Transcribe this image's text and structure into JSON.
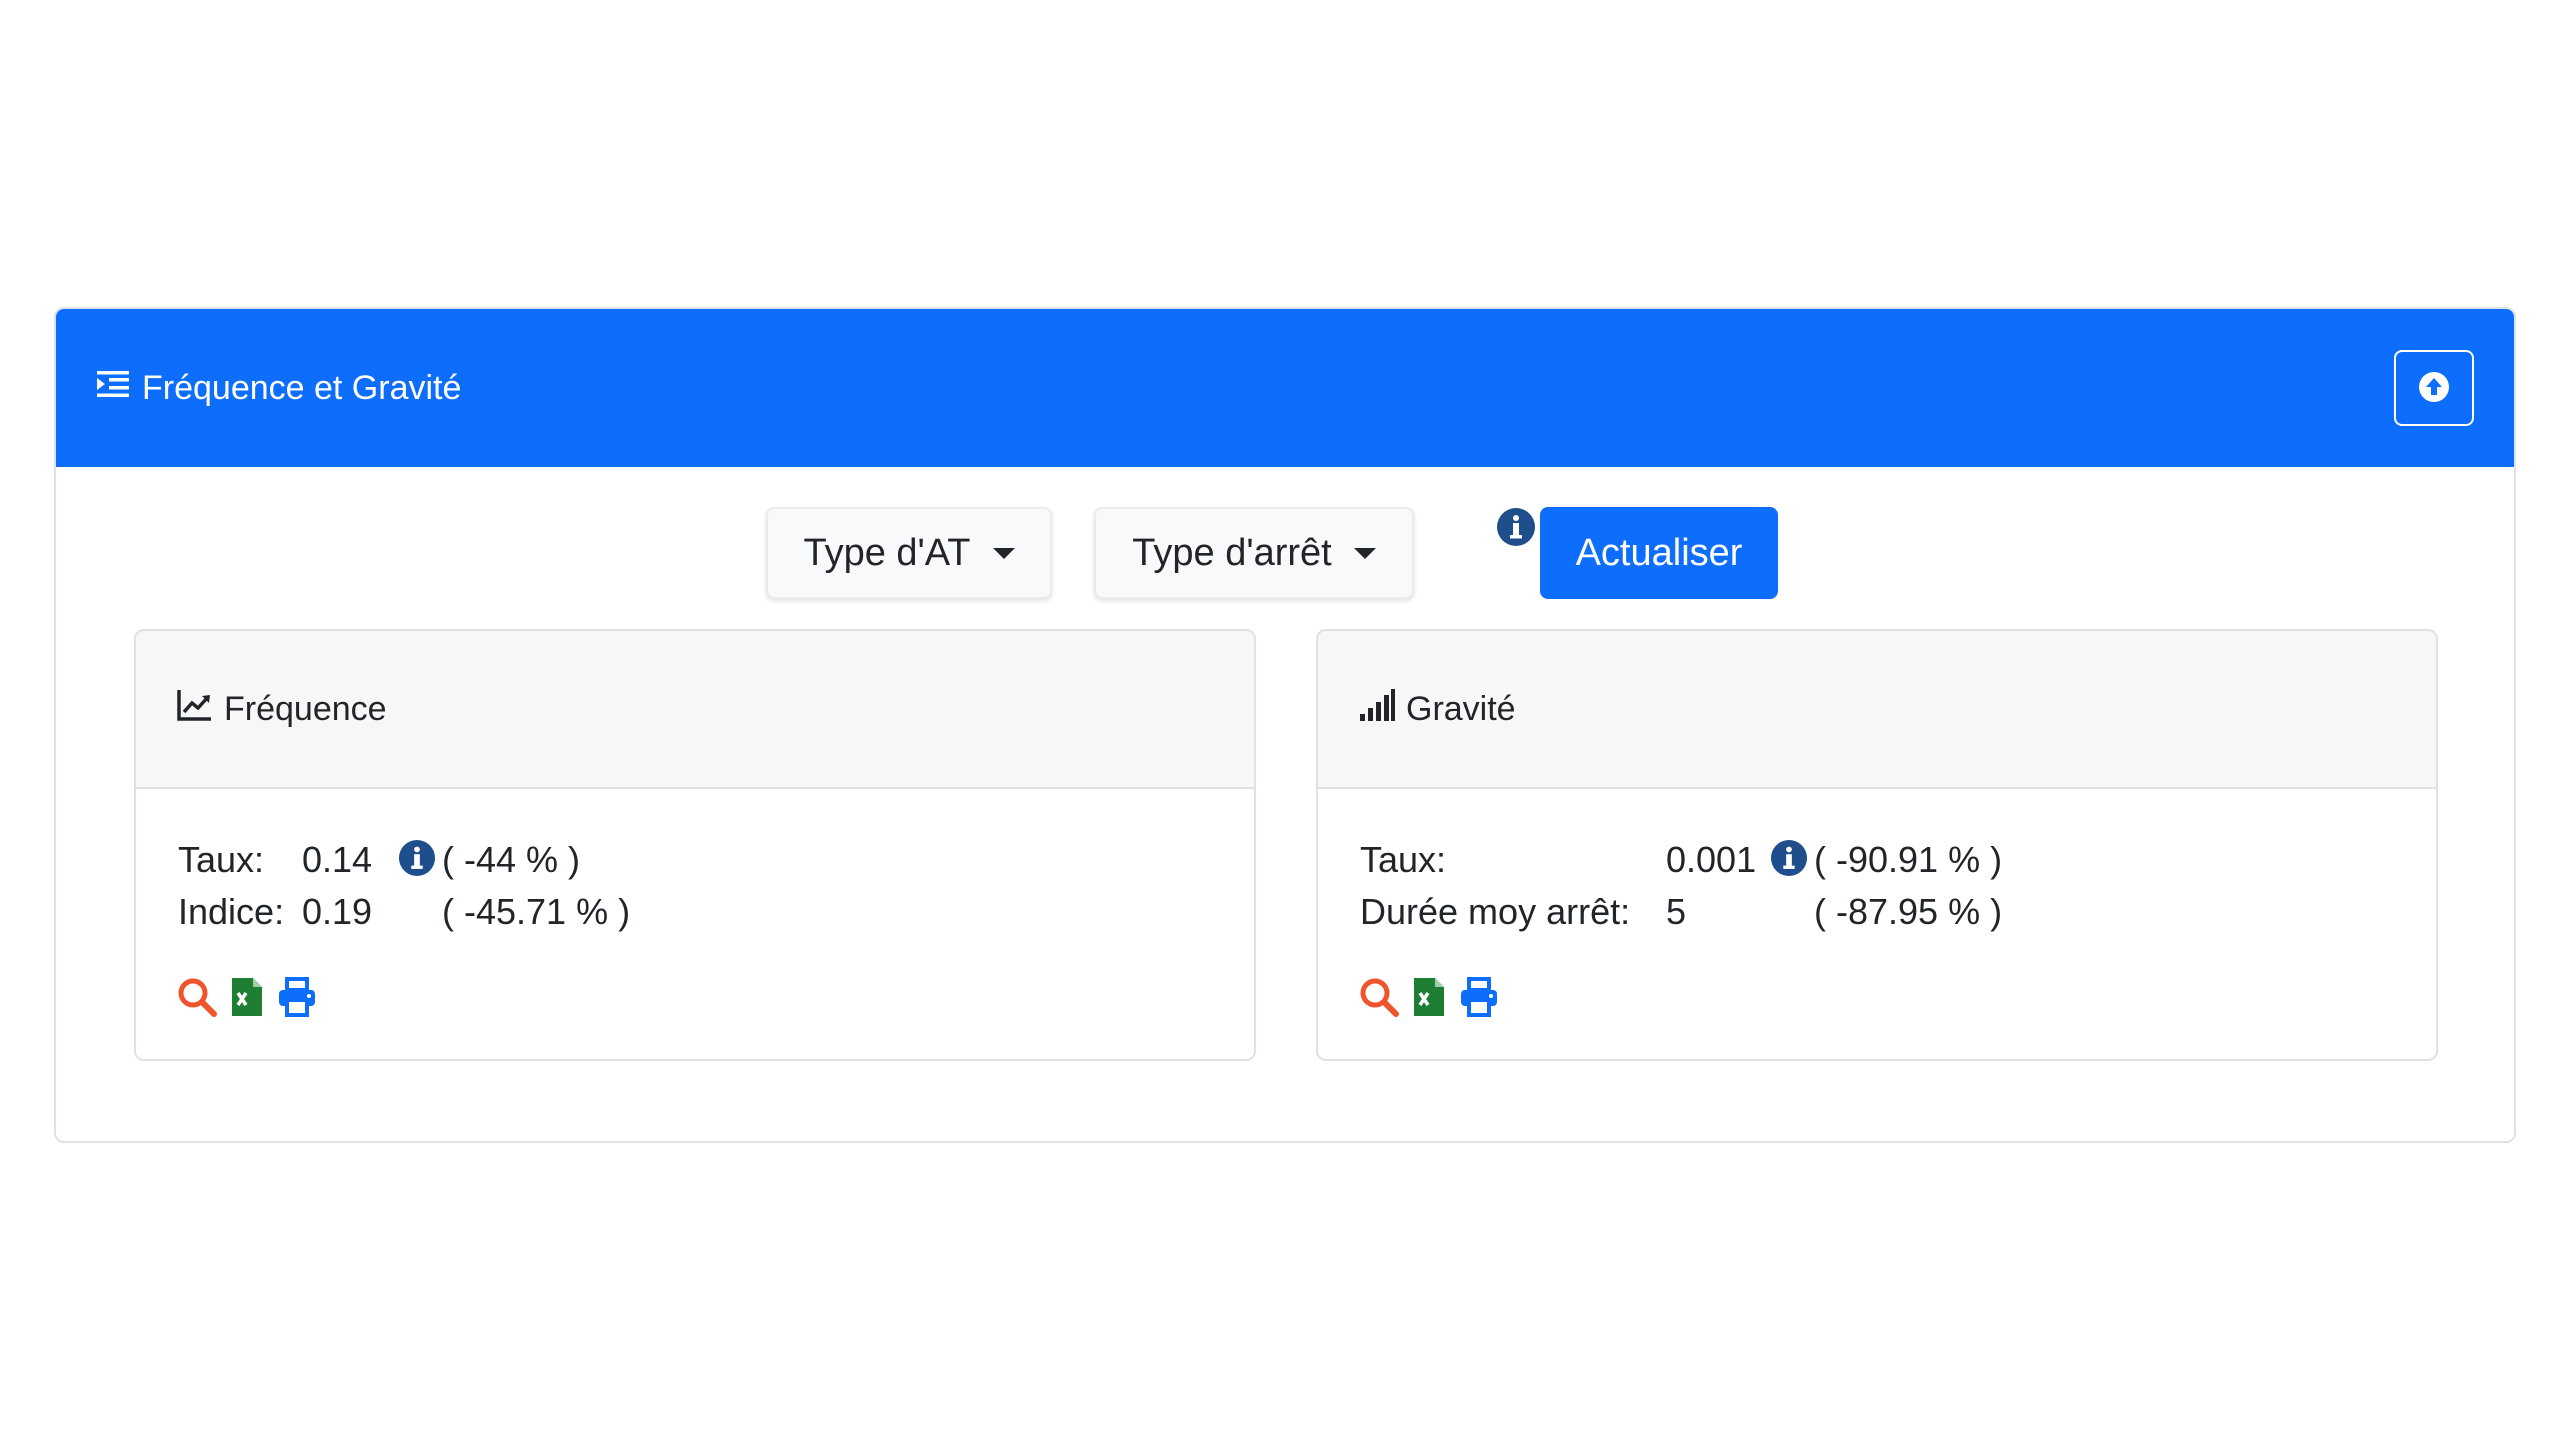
{
  "header": {
    "title": "Fréquence et Gravité",
    "icon": "list-indent-icon",
    "collapse_icon": "arrow-circle-up-icon"
  },
  "filters": {
    "type_at_label": "Type d'AT",
    "type_arret_label": "Type d'arrêt",
    "refresh_label": "Actualiser"
  },
  "frequence": {
    "title": "Fréquence",
    "icon": "chart-line-icon",
    "rows": [
      {
        "label": "Taux:",
        "value": "0.14",
        "change": "( -44 % )",
        "has_info": true
      },
      {
        "label": "Indice:",
        "value": "0.19",
        "change": "( -45.71 % )",
        "has_info": false
      }
    ]
  },
  "gravite": {
    "title": "Gravité",
    "icon": "signal-bars-icon",
    "rows": [
      {
        "label": "Taux:",
        "value": "0.001",
        "change": "( -90.91 % )",
        "has_info": true
      },
      {
        "label": "Durée moy arrêt:",
        "value": "5",
        "change": "( -87.95 % )",
        "has_info": false
      }
    ]
  },
  "colors": {
    "primary": "#0d6efd",
    "info_icon": "#1f4e8c",
    "search_icon": "#f0542d",
    "excel_icon": "#1e7e34",
    "print_icon": "#0d6efd"
  }
}
